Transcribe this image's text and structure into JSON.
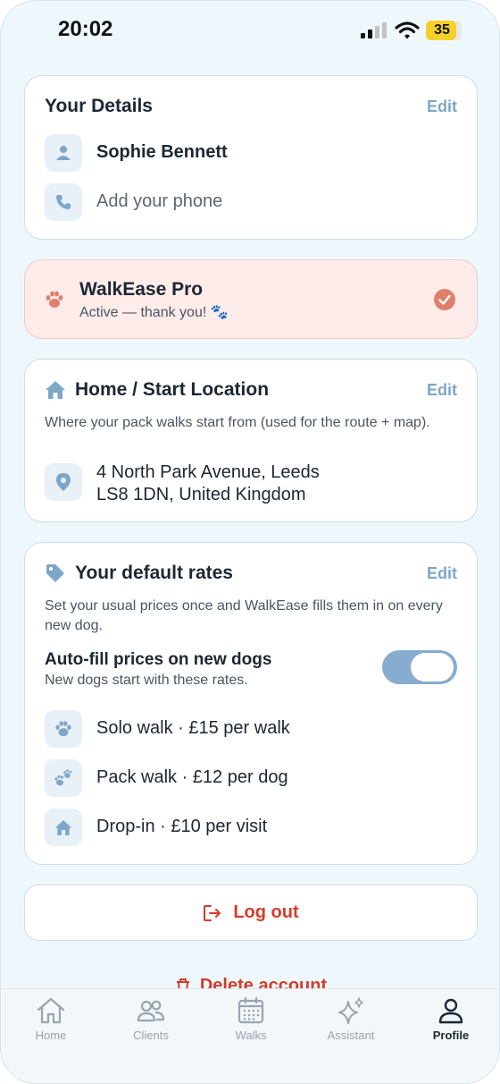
{
  "status_bar": {
    "time": "20:02",
    "battery": "35"
  },
  "details": {
    "title": "Your Details",
    "edit_label": "Edit",
    "name": "Sophie Bennett",
    "phone_placeholder": "Add your phone",
    "icons": [
      "person-icon",
      "phone-icon"
    ]
  },
  "pro": {
    "title": "WalkEase Pro",
    "subtitle": "Active — thank you! 🐾",
    "icons": [
      "paw-icon",
      "check-circle-icon"
    ]
  },
  "home_location": {
    "title": "Home / Start Location",
    "edit_label": "Edit",
    "description": "Where your pack walks start from (used for the route + map).",
    "address_line1": "4 North Park Avenue, Leeds",
    "address_line2": "LS8 1DN, United Kingdom",
    "icons": [
      "house-icon",
      "location-pin-icon"
    ]
  },
  "rates": {
    "title": "Your default rates",
    "edit_label": "Edit",
    "description": "Set your usual prices once and WalkEase fills them in on every new dog.",
    "autofill_title": "Auto-fill prices on new dogs",
    "autofill_subtitle": "New dogs start with these rates.",
    "autofill_enabled": true,
    "items": [
      {
        "label": "Solo walk · £15 per walk",
        "icon": "paw-icon"
      },
      {
        "label": "Pack walk · £12 per dog",
        "icon": "paws-icon"
      },
      {
        "label": "Drop-in · £10 per visit",
        "icon": "house-icon"
      }
    ]
  },
  "actions": {
    "logout": "Log out",
    "delete": "Delete account"
  },
  "tabs": [
    {
      "label": "Home",
      "icon": "house-outline-icon",
      "active": false
    },
    {
      "label": "Clients",
      "icon": "people-icon",
      "active": false
    },
    {
      "label": "Walks",
      "icon": "calendar-icon",
      "active": false
    },
    {
      "label": "Assistant",
      "icon": "sparkles-icon",
      "active": false
    },
    {
      "label": "Profile",
      "icon": "person-outline-icon",
      "active": true
    }
  ],
  "colors": {
    "accent": "#7ea6c8",
    "danger": "#d63a2a",
    "pro_background": "#fdecea",
    "pro_icon": "#e07f6c"
  }
}
